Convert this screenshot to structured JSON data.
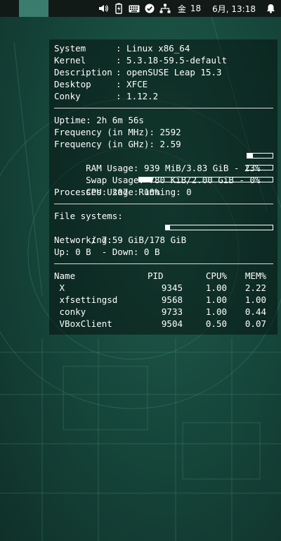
{
  "colors": {
    "panel_bg": "#121a18",
    "workspace_active": "#3a7d6e",
    "overlay": "rgba(0,0,0,0.42)"
  },
  "panel": {
    "workspace_active": true,
    "tray": {
      "icons": [
        "volume-icon",
        "battery-charging-icon",
        "keyboard-icon",
        "check-circle-icon",
        "network-wired-icon"
      ],
      "day_of_week": "金",
      "day": "18",
      "month_date_time": "6月, 13:18",
      "notification_icon": "bell-icon"
    }
  },
  "conky": {
    "system": [
      {
        "key": "System",
        "value": ": Linux x86_64"
      },
      {
        "key": "Kernel",
        "value": ": 5.3.18-59.5-default"
      },
      {
        "key": "Description",
        "value": ": openSUSE Leap 15.3"
      },
      {
        "key": "Desktop",
        "value": ": XFCE"
      },
      {
        "key": "Conky",
        "value": ": 1.12.2"
      }
    ],
    "stats": {
      "uptime": "Uptime: 2h 6m 56s",
      "freq_mhz": "Frequency (in MHz): 2592",
      "freq_ghz": "Frequency (in GHz): 2.59",
      "ram": "RAM Usage: 939 MiB/3.83 GiB - 23%",
      "ram_percent": 23,
      "swap": "Swap Usage: 780 KiB/2.00 GiB - 0%",
      "swap_percent": 0,
      "cpu": "CPU Usage: 10%",
      "cpu_percent": 10,
      "processes": "Processes: 207  Running: 0"
    },
    "filesystems": {
      "label": "File systems:",
      "root": " / 7.59 GiB/178 GiB",
      "root_percent": 4,
      "networking_label": "Networking:",
      "network": "Up: 0 B  - Down: 0 B"
    },
    "processes": {
      "headers": {
        "name": "Name",
        "pid": "PID",
        "cpu": "CPU%",
        "mem": "MEM%"
      },
      "rows": [
        {
          "name": " X",
          "pid": "9345",
          "cpu": "1.00",
          "mem": "2.22"
        },
        {
          "name": " xfsettingsd",
          "pid": "9568",
          "cpu": "1.00",
          "mem": "1.00"
        },
        {
          "name": " conky",
          "pid": "9733",
          "cpu": "1.00",
          "mem": "0.44"
        },
        {
          "name": " VBoxClient",
          "pid": "9504",
          "cpu": "0.50",
          "mem": "0.07"
        }
      ]
    }
  }
}
